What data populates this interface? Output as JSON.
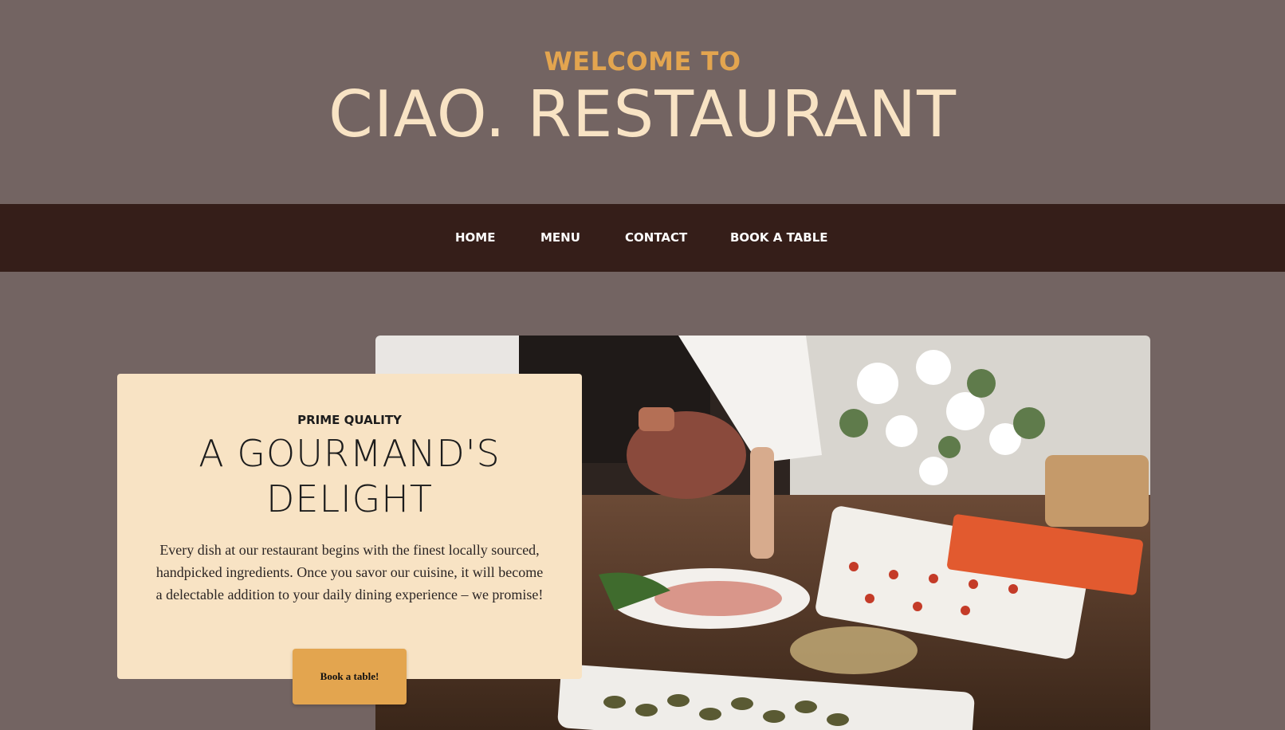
{
  "header": {
    "welcome": "WELCOME TO",
    "brand": "CIAO. RESTAURANT"
  },
  "nav": {
    "items": [
      "HOME",
      "MENU",
      "CONTACT",
      "BOOK A TABLE"
    ]
  },
  "feature": {
    "eyebrow": "PRIME QUALITY",
    "headline": "A GOURMAND'S DELIGHT",
    "body": "Every dish at our restaurant begins with the finest locally sourced, handpicked ingredients. Once you savor our cuisine, it will become a delectable addition to your daily dining experience – we promise!",
    "cta": "Book a table!",
    "image": "restaurant-buffet-photo"
  },
  "colors": {
    "background": "#736462",
    "nav": "#351e19",
    "accent": "#e3a54f",
    "cream": "#f8e3c4"
  }
}
